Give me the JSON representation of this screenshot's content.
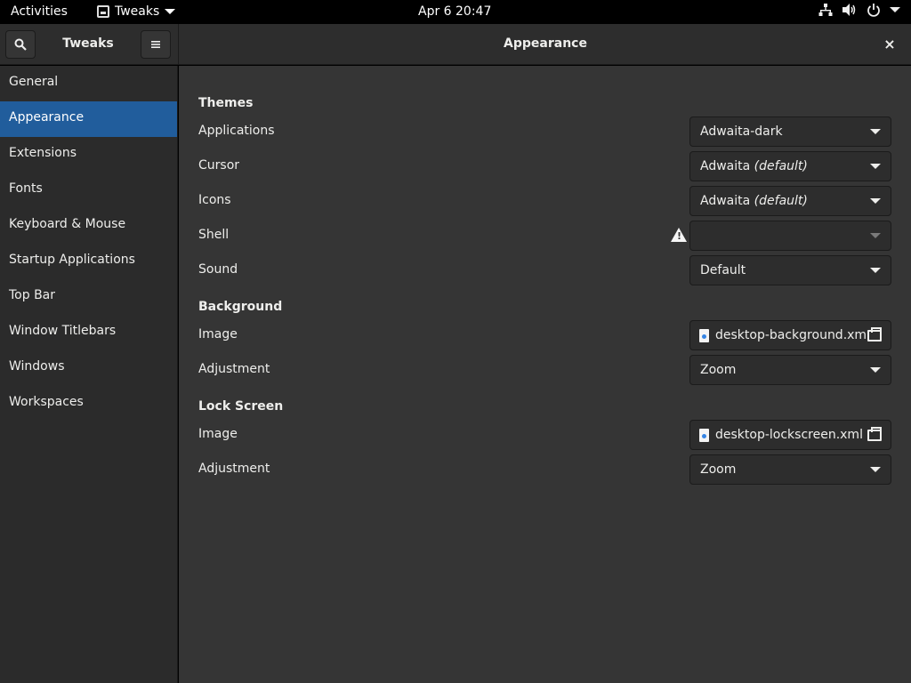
{
  "topbar": {
    "activities": "Activities",
    "app_name": "Tweaks",
    "clock": "Apr 6  20:47",
    "status_icons": [
      "network-icon",
      "volume-icon",
      "power-icon"
    ]
  },
  "headerbar": {
    "left_title": "Tweaks",
    "right_title": "Appearance",
    "close_glyph": "×"
  },
  "sidebar": {
    "items": [
      {
        "label": "General"
      },
      {
        "label": "Appearance",
        "selected": true
      },
      {
        "label": "Extensions"
      },
      {
        "label": "Fonts"
      },
      {
        "label": "Keyboard & Mouse"
      },
      {
        "label": "Startup Applications"
      },
      {
        "label": "Top Bar"
      },
      {
        "label": "Window Titlebars"
      },
      {
        "label": "Windows"
      },
      {
        "label": "Workspaces"
      }
    ]
  },
  "themes": {
    "title": "Themes",
    "applications": {
      "label": "Applications",
      "value": "Adwaita-dark"
    },
    "cursor": {
      "label": "Cursor",
      "value": "Adwaita",
      "suffix": "(default)"
    },
    "icons": {
      "label": "Icons",
      "value": "Adwaita",
      "suffix": "(default)"
    },
    "shell": {
      "label": "Shell",
      "value": ""
    },
    "sound": {
      "label": "Sound",
      "value": "Default"
    }
  },
  "background": {
    "title": "Background",
    "image": {
      "label": "Image",
      "file": "desktop-background.xml"
    },
    "adjustment": {
      "label": "Adjustment",
      "value": "Zoom"
    }
  },
  "lockscreen": {
    "title": "Lock Screen",
    "image": {
      "label": "Image",
      "file": "desktop-lockscreen.xml"
    },
    "adjustment": {
      "label": "Adjustment",
      "value": "Zoom"
    }
  },
  "colors": {
    "accent": "#215d9c",
    "window_bg": "#353535",
    "sidebar_bg": "#2b2b2b",
    "topbar_bg": "#000000"
  }
}
